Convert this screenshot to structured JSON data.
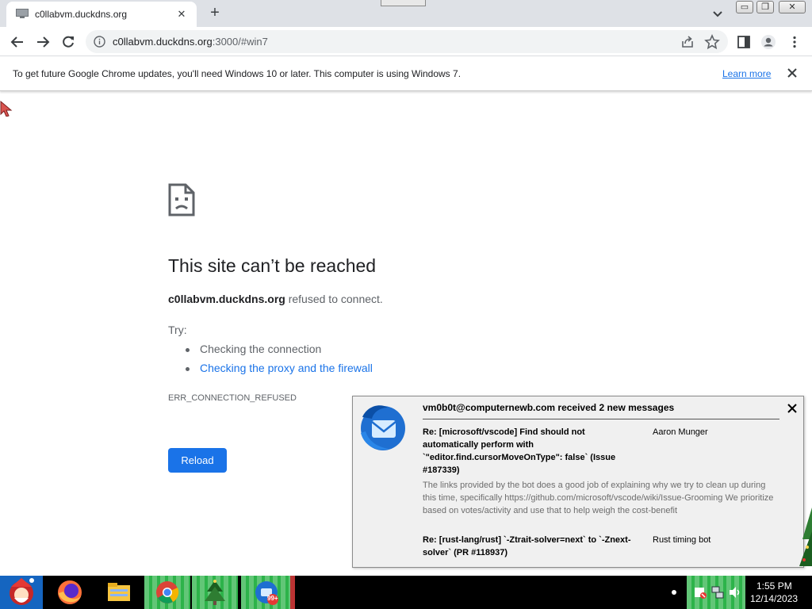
{
  "browser": {
    "tab": {
      "title": "c0llabvm.duckdns.org",
      "close_glyph": "✕"
    },
    "new_tab_glyph": "+",
    "window_controls": {
      "minimize": "▭",
      "maximize": "❐",
      "close": "✕"
    },
    "address": {
      "host": "c0llabvm.duckdns.org",
      "rest": ":3000/#win7"
    },
    "icons": [
      "back-arrow-icon",
      "forward-arrow-icon",
      "reload-icon",
      "info-icon",
      "share-icon",
      "star-icon",
      "side-panel-icon",
      "profile-icon",
      "kebab-menu-icon"
    ]
  },
  "infobar": {
    "text": "To get future Google Chrome updates, you'll need Windows 10 or later. This computer is using Windows 7.",
    "link": "Learn more"
  },
  "error_page": {
    "title": "This site can’t be reached",
    "host": "c0llabvm.duckdns.org",
    "desc_suffix": " refused to connect.",
    "try_label": "Try:",
    "suggestions": [
      "Checking the connection",
      "Checking the proxy and the firewall"
    ],
    "code": "ERR_CONNECTION_REFUSED",
    "reload_label": "Reload"
  },
  "notification": {
    "header": "vm0b0t@computernewb.com received 2 new messages",
    "messages": [
      {
        "subject": "Re: [microsoft/vscode] Find should not automatically perform with `\"editor.find.cursorMoveOnType\": false` (Issue #187339)",
        "from": "Aaron Munger",
        "preview": "The links provided by the bot does a good job of explaining why we try to clean up during this time, specifically https://github.com/microsoft/vscode/wiki/Issue-Grooming We prioritize based on votes/activity and use that to help weigh the cost-benefit"
      },
      {
        "subject": "Re: [rust-lang/rust] `-Ztrait-solver=next` to `-Znext-solver` (PR #118937)",
        "from": "Rust timing bot",
        "preview": ""
      }
    ]
  },
  "taskbar": {
    "badge": "99+",
    "clock_time": "1:55 PM",
    "clock_date": "12/14/2023"
  },
  "colors": {
    "link": "#1a73e8",
    "button": "#1a73e8",
    "taskbar_green": "#2db34a"
  }
}
